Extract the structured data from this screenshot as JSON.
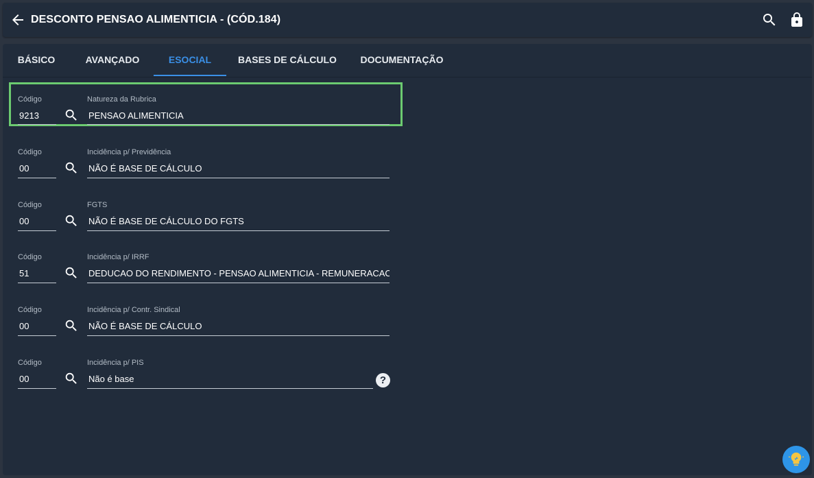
{
  "header": {
    "title": "DESCONTO PENSAO ALIMENTICIA - (CÓD.184)",
    "icons": [
      "arrow-back-icon",
      "search-icon",
      "lock-icon"
    ]
  },
  "tabs": [
    {
      "label": "BÁSICO",
      "active": false
    },
    {
      "label": "AVANÇADO",
      "active": false
    },
    {
      "label": "ESOCIAL",
      "active": true
    },
    {
      "label": "BASES DE CÁLCULO",
      "active": false
    },
    {
      "label": "DOCUMENTAÇÃO",
      "active": false
    }
  ],
  "fields": [
    {
      "code_label": "Código",
      "code": "9213",
      "desc_label": "Natureza da Rubrica",
      "desc": "PENSAO ALIMENTICIA"
    },
    {
      "code_label": "Código",
      "code": "00",
      "desc_label": "Incidência p/ Previdência",
      "desc": "NÃO É BASE DE CÁLCULO"
    },
    {
      "code_label": "Código",
      "code": "00",
      "desc_label": "FGTS",
      "desc": "NÃO É BASE DE CÁLCULO DO FGTS"
    },
    {
      "code_label": "Código",
      "code": "51",
      "desc_label": "Incidência p/ IRRF",
      "desc": "DEDUCAO DO RENDIMENTO - PENSAO ALIMENTICIA - REMUNERACAO MENSAL"
    },
    {
      "code_label": "Código",
      "code": "00",
      "desc_label": "Incidência p/ Contr. Sindical",
      "desc": "NÃO É BASE DE CÁLCULO"
    },
    {
      "code_label": "Código",
      "code": "00",
      "desc_label": "Incidência p/ PIS",
      "desc": "Não é base"
    }
  ],
  "help": {
    "symbol": "?"
  },
  "colors": {
    "background": "#2c3440",
    "panel": "#212c3b",
    "accent": "#3a8fe6",
    "highlight": "#6ccb70",
    "fab": "#2e95e8"
  }
}
